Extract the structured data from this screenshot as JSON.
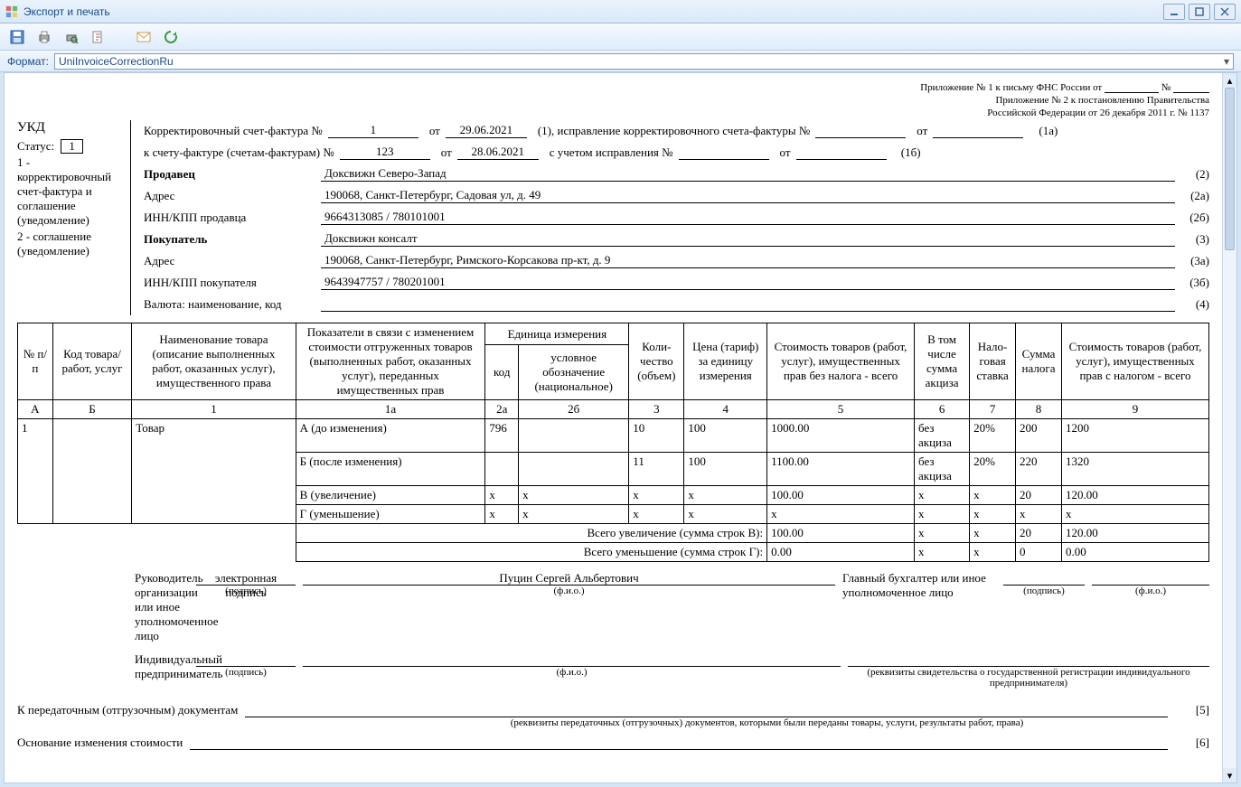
{
  "window": {
    "title": "Экспорт и печать"
  },
  "format": {
    "label": "Формат:",
    "value": "UniInvoiceCorrectionRu"
  },
  "appendix": {
    "line1_prefix": "Приложение № 1 к письму ФНС России от",
    "line1_no": "№",
    "line2": "Приложение № 2 к постановлению Правительства",
    "line3": "Российской Федерации от 26 декабря 2011 г. № 1137"
  },
  "ukd": {
    "title": "УКД",
    "status_label": "Статус:",
    "status_value": "1",
    "legend1": "1 - корректировочный счет-фактура и соглашение (уведомление)",
    "legend2": "2 - соглашение (уведомление)"
  },
  "head": {
    "line1_prefix": "Корректировочный счет-фактура №",
    "ksf_no": "1",
    "from1": "от",
    "ksf_date": "29.06.2021",
    "line1_mid": "(1), исправление корректировочного счета-фактуры №",
    "from2": "от",
    "ref1a": "(1а)",
    "line2_prefix": "к счету-фактуре (счетам-фактурам) №",
    "sf_no": "123",
    "from3": "от",
    "sf_date": "28.06.2021",
    "line2_mid": "с учетом исправления №",
    "from4": "от",
    "ref1b": "(1б)",
    "seller_lbl": "Продавец",
    "seller": "Доксвижн Северо-Запад",
    "ref2": "(2)",
    "addr_lbl": "Адрес",
    "seller_addr": "190068, Санкт-Петербург, Садовая ул, д. 49",
    "ref2a": "(2а)",
    "seller_inn_lbl": "ИНН/КПП продавца",
    "seller_inn": "9664313085 / 780101001",
    "ref2b": "(2б)",
    "buyer_lbl": "Покупатель",
    "buyer": "Доксвижн консалт",
    "ref3": "(3)",
    "buyer_addr": "190068, Санкт-Петербург, Римского-Корсакова пр-кт, д. 9",
    "ref3a": "(3а)",
    "buyer_inn_lbl": "ИНН/КПП покупателя",
    "buyer_inn": "9643947757 / 780201001",
    "ref3b": "(3б)",
    "currency_lbl": "Валюта: наименование, код",
    "currency": "",
    "ref4": "(4)"
  },
  "th": {
    "a": "№ п/п",
    "b": "Код товара/ работ, услуг",
    "c1": "Наименование товара (описание выполненных работ, оказанных услуг), имущественного права",
    "c1a": "Показатели в связи с изменением стоимости отгруженных товаров (выполненных работ, оказанных услуг), переданных имущественных прав",
    "unit": "Единица измерения",
    "c2a": "код",
    "c2b": "условное обозначение (национальное)",
    "c3": "Коли-чество (объем)",
    "c4": "Цена (тариф) за единицу измерения",
    "c5": "Стоимость товаров (работ, услуг), имущественных прав без налога - всего",
    "c6": "В том числе сумма акциза",
    "c7": "Нало-говая ставка",
    "c8": "Сумма налога",
    "c9": "Стоимость товаров (работ, услуг), имущественных прав с налогом - всего"
  },
  "th_row2": {
    "a": "А",
    "b": "Б",
    "c1": "1",
    "c1a": "1а",
    "c2a": "2а",
    "c2b": "2б",
    "c3": "3",
    "c4": "4",
    "c5": "5",
    "c6": "6",
    "c7": "7",
    "c8": "8",
    "c9": "9"
  },
  "item": {
    "n": "1",
    "code": "",
    "name": "Товар",
    "rows": {
      "a": {
        "label": "А (до изменения)",
        "c2a": "796",
        "c2b": "",
        "c3": "10",
        "c4": "100",
        "c5": "1000.00",
        "c6": "без акциза",
        "c7": "20%",
        "c8": "200",
        "c9": "1200"
      },
      "b": {
        "label": "Б (после изменения)",
        "c2a": "",
        "c2b": "",
        "c3": "11",
        "c4": "100",
        "c5": "1100.00",
        "c6": "без акциза",
        "c7": "20%",
        "c8": "220",
        "c9": "1320"
      },
      "v": {
        "label": "В (увеличение)",
        "c2a": "х",
        "c2b": "х",
        "c3": "х",
        "c4": "х",
        "c5": "100.00",
        "c6": "х",
        "c7": "х",
        "c8": "20",
        "c9": "120.00"
      },
      "g": {
        "label": "Г (уменьшение)",
        "c2a": "х",
        "c2b": "х",
        "c3": "х",
        "c4": "х",
        "c5": "х",
        "c6": "х",
        "c7": "х",
        "c8": "х",
        "c9": "х"
      }
    }
  },
  "totals": {
    "inc_lbl": "Всего увеличение (сумма строк В):",
    "inc": {
      "c5": "100.00",
      "c6": "х",
      "c7": "х",
      "c8": "20",
      "c9": "120.00"
    },
    "dec_lbl": "Всего уменьшение (сумма строк Г):",
    "dec": {
      "c5": "0.00",
      "c6": "х",
      "c7": "х",
      "c8": "0",
      "c9": "0.00"
    }
  },
  "sign": {
    "leader_lbl": "Руководитель организации или иное уполномоченное лицо",
    "esig": "электронная подпись",
    "podpis": "(подпись)",
    "fio": "(ф.и.о.)",
    "name": "Пуцин Сергей Альбертович",
    "acc_lbl": "Главный бухгалтер или иное уполномоченное лицо",
    "ip_lbl": "Индивидуальный предприниматель",
    "ip_note": "(реквизиты свидетельства о государственной регистрации индивидуального предпринимателя)"
  },
  "transfer": {
    "lbl": "К передаточным (отгрузочным) документам",
    "ref": "[5]",
    "note": "(реквизиты передаточных (отгрузочных) документов, которыми были переданы товары, услуги, результаты работ, права)"
  },
  "reason": {
    "lbl": "Основание изменения стоимости",
    "ref": "[6]"
  }
}
